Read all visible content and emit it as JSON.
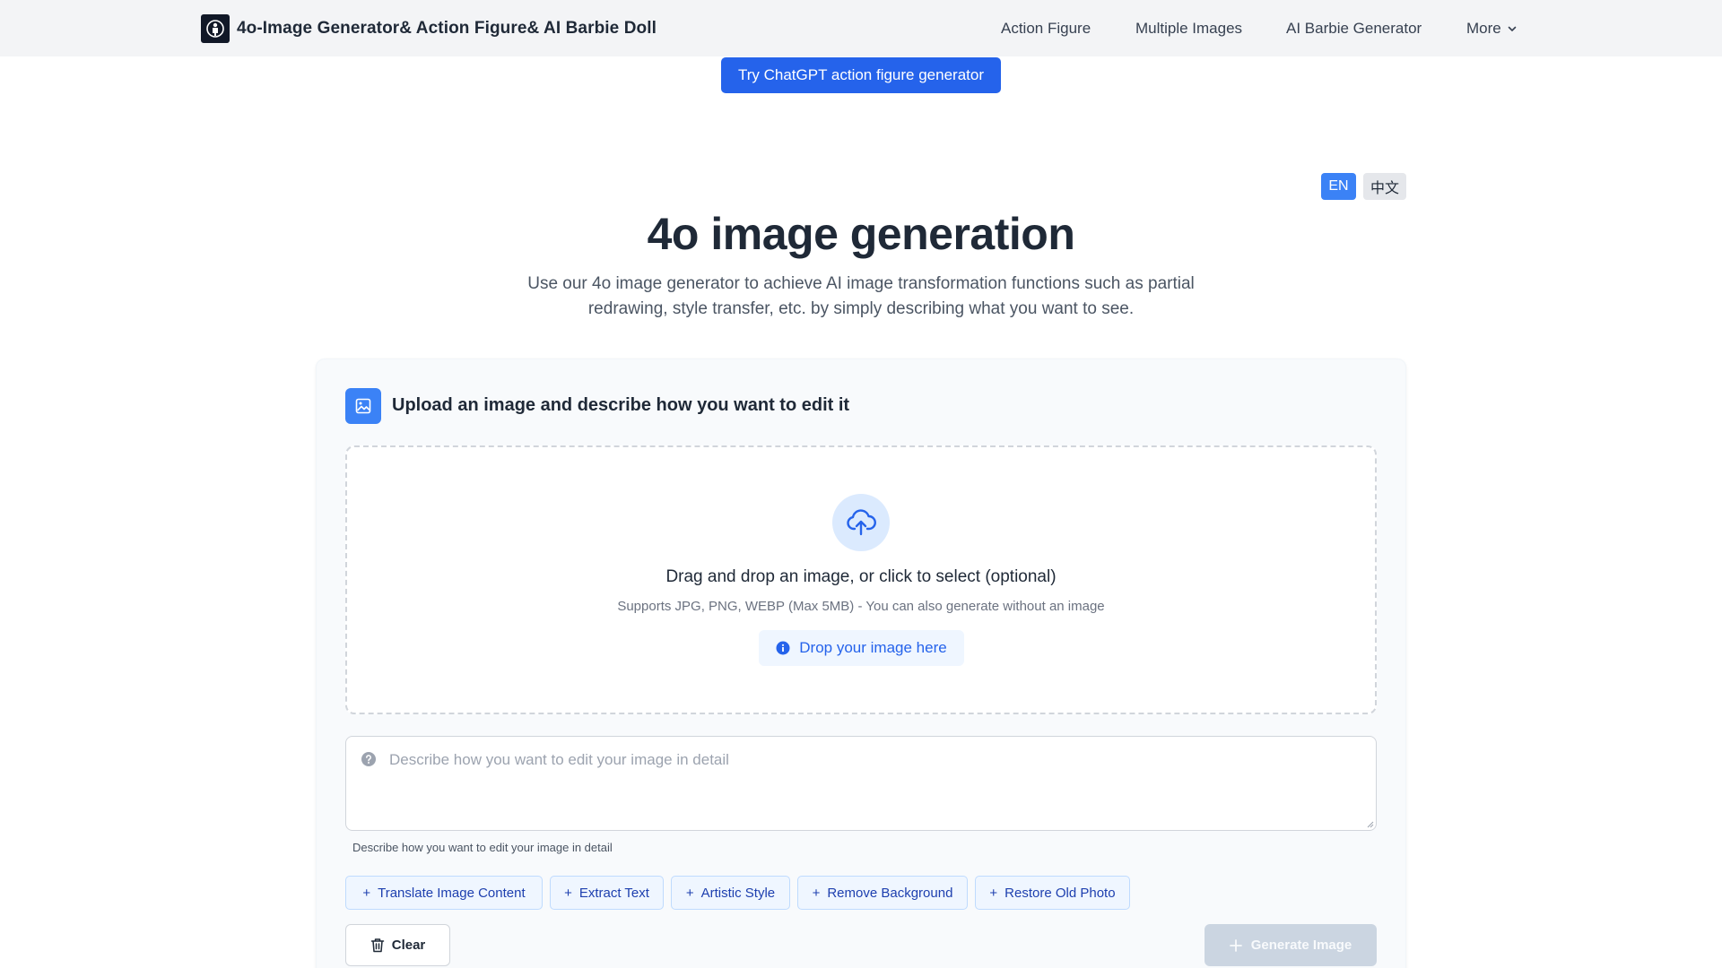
{
  "header": {
    "brand_title": "4o-Image Generator& Action Figure& AI Barbie Doll",
    "logo_icon": "figure-logo-icon",
    "nav": {
      "action_figure": "Action Figure",
      "multiple_images": "Multiple Images",
      "ai_barbie": "AI Barbie Generator",
      "more": "More"
    }
  },
  "cta": {
    "label": "Try ChatGPT action figure generator"
  },
  "language": {
    "en": "EN",
    "zh": "中文",
    "selected": "EN"
  },
  "hero": {
    "title": "4o image generation",
    "subtitle": "Use our 4o image generator to achieve AI image transformation functions such as partial redrawing, style transfer, etc. by simply describing what you want to see."
  },
  "card": {
    "title": "Upload an image and describe how you want to edit it",
    "dropzone": {
      "title": "Drag and drop an image, or click to select (optional)",
      "subtitle": "Supports JPG, PNG, WEBP (Max 5MB) - You can also generate without an image",
      "pill": "Drop your image here"
    },
    "prompt": {
      "placeholder": "Describe how you want to edit your image in detail",
      "value": "",
      "hint": "Describe how you want to edit your image in detail"
    },
    "chips": {
      "translate": "Translate Image Content",
      "extract": "Extract Text",
      "artistic": "Artistic Style",
      "remove_bg": "Remove Background",
      "restore": "Restore Old Photo"
    },
    "buttons": {
      "clear": "Clear",
      "generate": "Generate Image"
    }
  },
  "colors": {
    "primary": "#2563eb",
    "accent": "#3b82f6",
    "header_bg": "#f3f4f6",
    "disabled": "#cbd5e1"
  }
}
